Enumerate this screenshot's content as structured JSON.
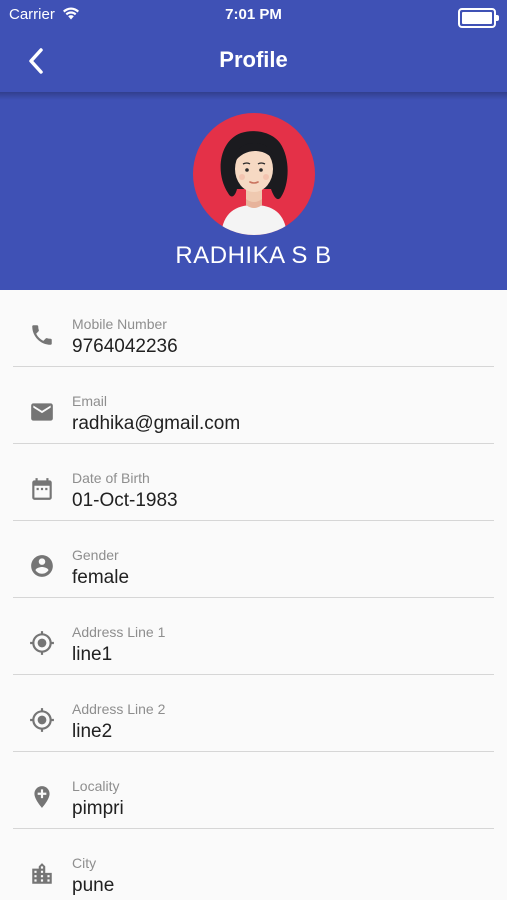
{
  "status_bar": {
    "carrier": "Carrier",
    "time": "7:01 PM"
  },
  "appbar": {
    "title": "Profile",
    "back_icon": "chevron-left-icon"
  },
  "profile": {
    "name": "RADHIKA S B",
    "avatar_bg": "#e43148"
  },
  "colors": {
    "primary": "#3f51b5",
    "icon": "#757575",
    "label": "#8e8e8e",
    "value": "#212121",
    "divider": "#d6d6d6"
  },
  "fields": [
    {
      "label": "Mobile Number",
      "value": "9764042236",
      "icon": "phone-icon"
    },
    {
      "label": "Email",
      "value": "radhika@gmail.com",
      "icon": "email-icon"
    },
    {
      "label": "Date of Birth",
      "value": "01-Oct-1983",
      "icon": "calendar-icon"
    },
    {
      "label": "Gender",
      "value": "female",
      "icon": "account-circle-icon"
    },
    {
      "label": "Address Line 1",
      "value": "line1",
      "icon": "location-target-icon"
    },
    {
      "label": "Address Line 2",
      "value": "line2",
      "icon": "location-target-icon"
    },
    {
      "label": "Locality",
      "value": "pimpri",
      "icon": "add-location-icon"
    },
    {
      "label": "City",
      "value": "pune",
      "icon": "city-icon"
    }
  ]
}
